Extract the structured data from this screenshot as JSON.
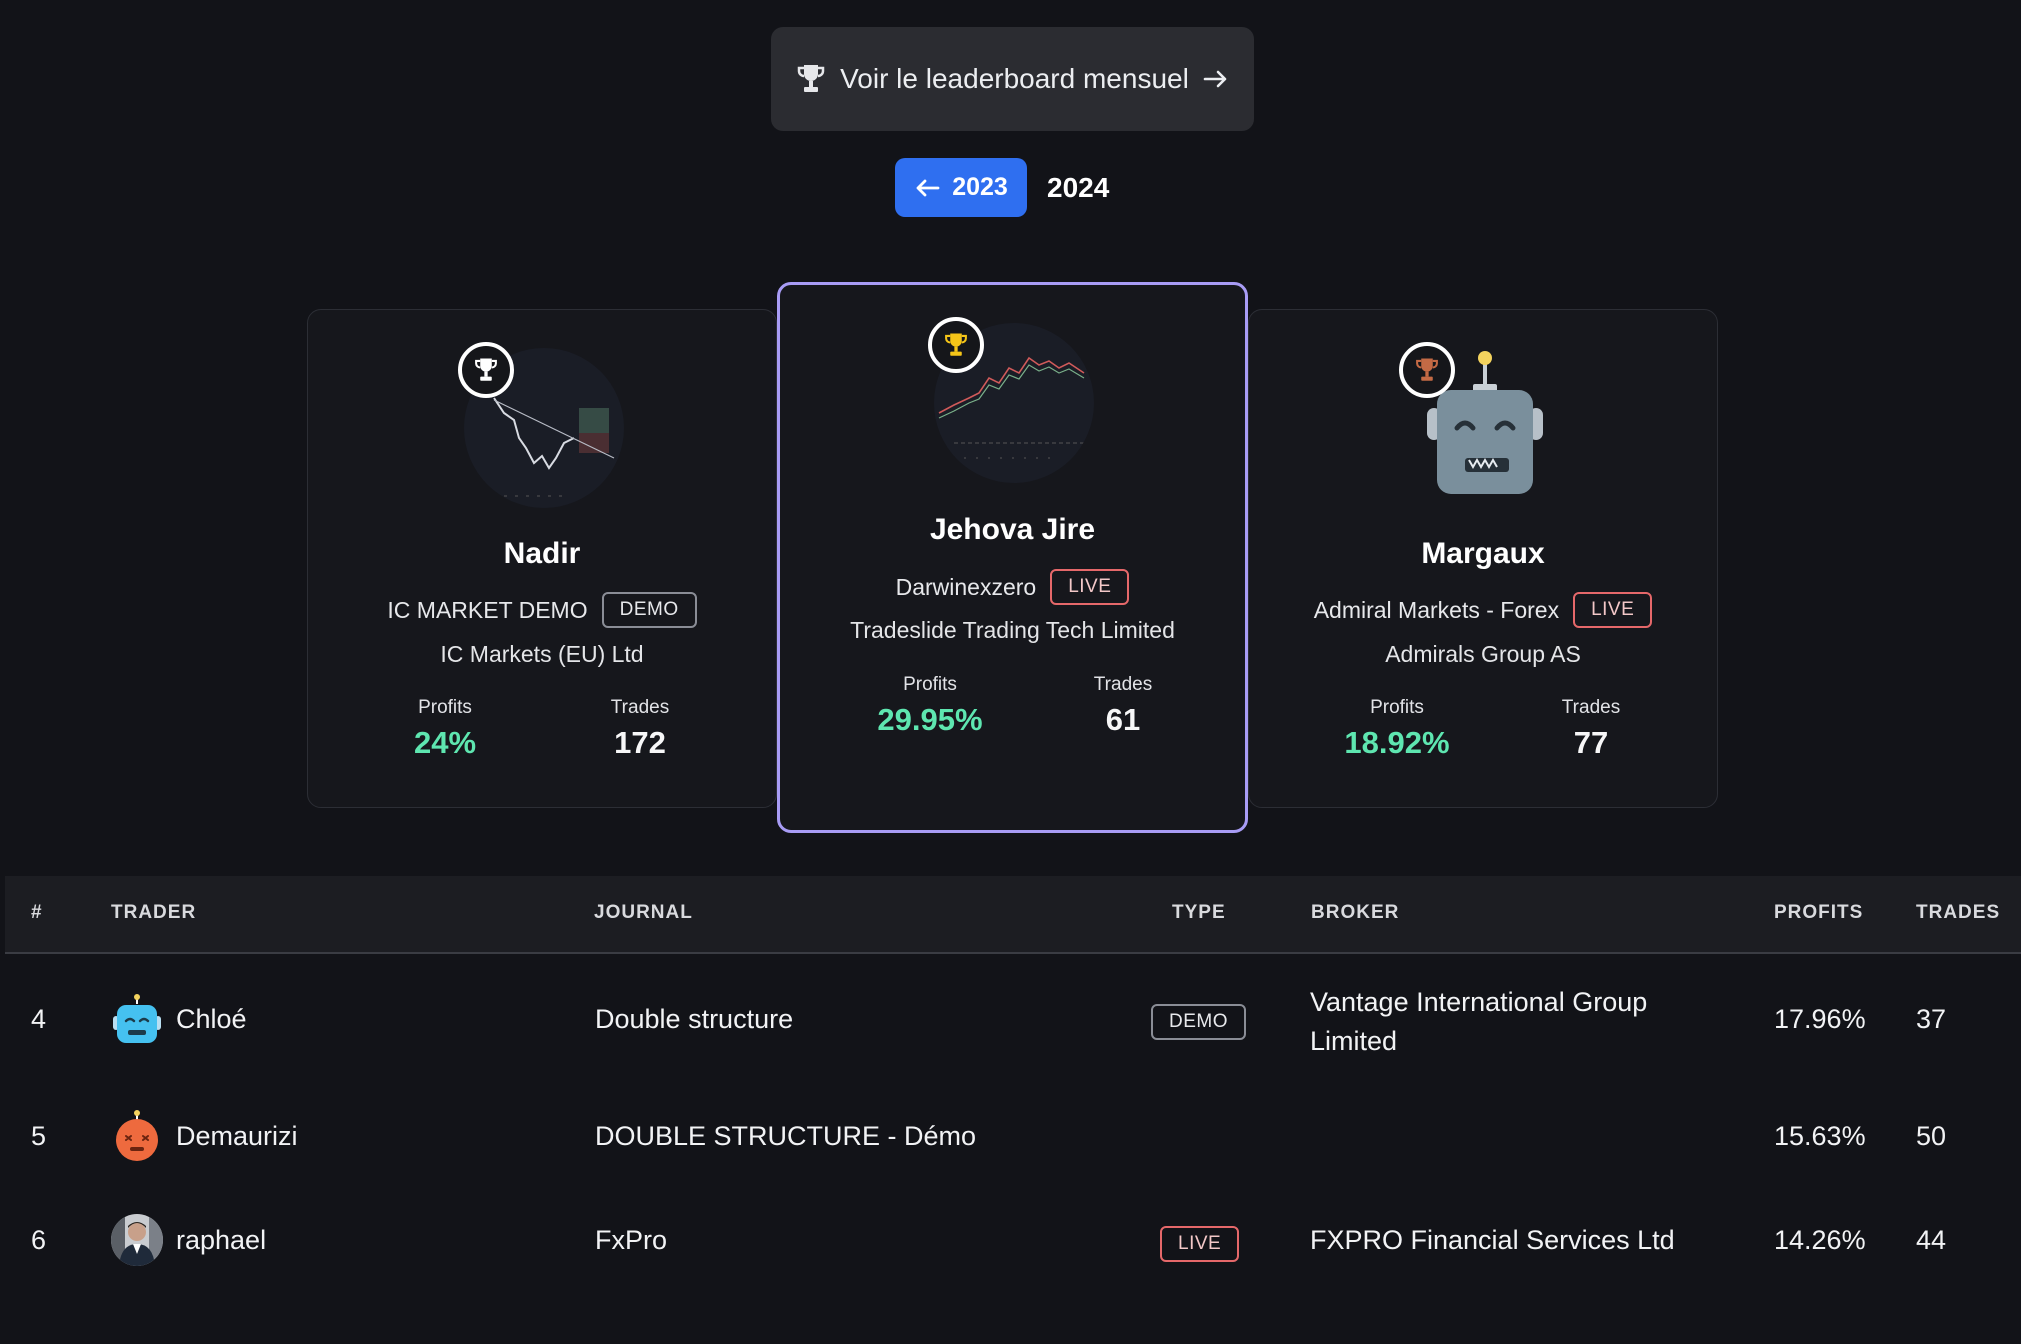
{
  "monthly_button": {
    "label": "Voir le leaderboard mensuel"
  },
  "year_nav": {
    "previous_year": "2023",
    "current_year": "2024"
  },
  "podium": [
    {
      "rank": 2,
      "name": "Nadir",
      "journal": "IC MARKET DEMO",
      "type": "DEMO",
      "broker": "IC Markets (EU) Ltd",
      "profits_label": "Profits",
      "profits": "24%",
      "trades_label": "Trades",
      "trades": "172",
      "trophy_color": "#ffffff"
    },
    {
      "rank": 1,
      "name": "Jehova Jire",
      "journal": "Darwinexzero",
      "type": "LIVE",
      "broker": "Tradeslide Trading Tech Limited",
      "profits_label": "Profits",
      "profits": "29.95%",
      "trades_label": "Trades",
      "trades": "61",
      "trophy_color": "#f5c518"
    },
    {
      "rank": 3,
      "name": "Margaux",
      "journal": "Admiral Markets - Forex",
      "type": "LIVE",
      "broker": "Admirals Group AS",
      "profits_label": "Profits",
      "profits": "18.92%",
      "trades_label": "Trades",
      "trades": "77",
      "trophy_color": "#c46a45"
    }
  ],
  "table": {
    "headers": {
      "rank": "#",
      "trader": "TRADER",
      "journal": "JOURNAL",
      "type": "TYPE",
      "broker": "BROKER",
      "profits": "PROFITS",
      "trades": "TRADES"
    },
    "rows": [
      {
        "rank": "4",
        "trader": "Chloé",
        "journal": "Double structure",
        "type": "DEMO",
        "broker_line1": "Vantage International Group",
        "broker_line2": "Limited",
        "profits": "17.96%",
        "trades": "37"
      },
      {
        "rank": "5",
        "trader": "Demaurizi",
        "journal": "DOUBLE STRUCTURE - Démo",
        "type": "",
        "broker_line1": "",
        "broker_line2": "",
        "profits": "15.63%",
        "trades": "50"
      },
      {
        "rank": "6",
        "trader": "raphael",
        "journal": "FxPro",
        "type": "LIVE",
        "broker_line1": "FXPRO Financial Services Ltd",
        "broker_line2": "",
        "profits": "14.26%",
        "trades": "44"
      }
    ]
  },
  "colors": {
    "accent": "#2f6ff0",
    "profit": "#5ee6b0",
    "live": "#e5686a",
    "first_border": "#a89cf5"
  }
}
